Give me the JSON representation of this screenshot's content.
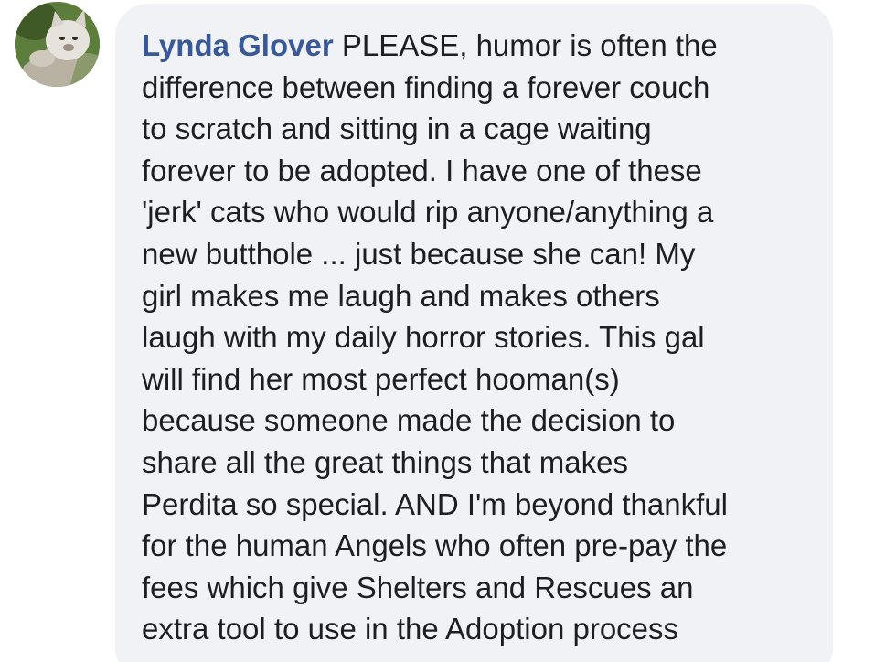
{
  "comment": {
    "author": "Lynda Glover",
    "avatar_icon": "profile-photo-cat-icon",
    "colors": {
      "author": "#385898",
      "text": "#1c1e21",
      "bubble": "#f0f2f5"
    },
    "lines": [
      " PLEASE, humor is often the",
      "difference between finding a forever couch",
      "to scratch and sitting in a cage waiting",
      "forever to be adopted. I have one of these",
      "'jerk' cats who would rip anyone/anything a",
      "new butthole ... just because she can! My",
      "girl makes me laugh and makes others",
      "laugh with my daily horror stories. This gal",
      "will find her most perfect hooman(s)",
      "because someone made the decision to",
      "share all the great things that makes",
      "Perdita so special. AND I'm beyond thankful",
      "for the human Angels who often pre-pay the",
      "fees which give Shelters and Rescues an",
      "extra tool to use in the Adoption process"
    ]
  }
}
